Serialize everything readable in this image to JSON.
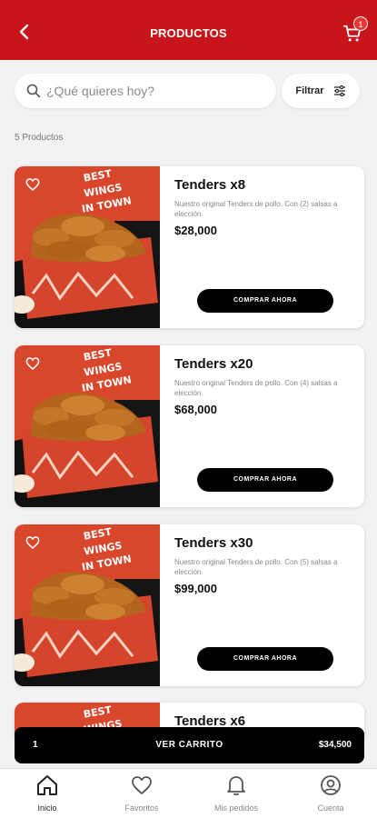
{
  "header": {
    "title": "PRODUCTOS",
    "cart_count": "1"
  },
  "search": {
    "placeholder": "¿Qué quieres hoy?",
    "filter_label": "Filtrar"
  },
  "products_count": "5 Productos",
  "image_text": {
    "line1": "BEST",
    "line2": "WINGS",
    "line3": "IN TOWN"
  },
  "products": [
    {
      "name": "Tenders x8",
      "description": "Nuestro original Tenders de pollo. Con (2) salsas a elección.",
      "price": "$28,000",
      "button": "COMPRAR AHORA"
    },
    {
      "name": "Tenders x20",
      "description": "Nuestro original Tenders de pollo. Con (4) salsas a elección.",
      "price": "$68,000",
      "button": "COMPRAR AHORA"
    },
    {
      "name": "Tenders x30",
      "description": "Nuestro original Tenders de pollo. Con (5) salsas a elección.",
      "price": "$99,000",
      "button": "COMPRAR AHORA"
    },
    {
      "name": "Tenders x6",
      "description": "",
      "price": "",
      "button": ""
    }
  ],
  "cart_bar": {
    "quantity": "1",
    "label": "VER CARRITO",
    "total": "$34,500"
  },
  "nav": [
    {
      "label": "Inicio",
      "icon": "home-icon"
    },
    {
      "label": "Favoritos",
      "icon": "heart-icon"
    },
    {
      "label": "Mis pedidos",
      "icon": "bell-icon"
    },
    {
      "label": "Cuenta",
      "icon": "user-icon"
    }
  ],
  "colors": {
    "brand": "#c8151b",
    "box": "#d4452b",
    "dark": "#000000"
  }
}
